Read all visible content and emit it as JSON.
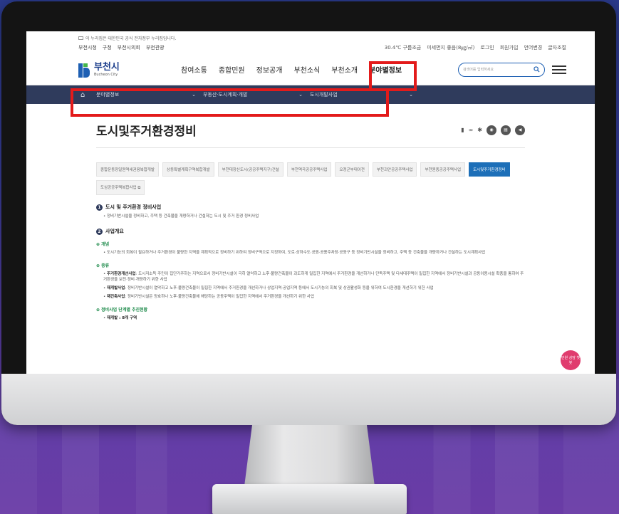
{
  "site": {
    "notice": "이 누리집은 대한민국 공식 전자정부 누리집입니다.",
    "util_left": [
      "부천시청",
      "구청",
      "부천시의회",
      "부천관광"
    ],
    "util_right": [
      "30.4℃ 구름조금",
      "미세먼지 좋음(8㎍/㎥)",
      "로그인",
      "회원가입",
      "언어변경",
      "글자조절"
    ],
    "logo_ko": "부천시",
    "logo_en": "Bucheon City",
    "menu": [
      "참여소통",
      "종합민원",
      "정보공개",
      "부천소식",
      "부천소개",
      "분야별정보"
    ],
    "search_placeholder": "검색어를 입력하세요",
    "subnav": [
      "분야별정보",
      "부동산·도시계획·개발",
      "도시개발사업"
    ]
  },
  "page": {
    "title": "도시및주거환경정비",
    "tabs": [
      "종합운동장일원역세권융복합개발",
      "상동특별계획구역복합개발",
      "부천대장신도시(공공주택지구)건설",
      "부천역곡공공주택사업",
      "오정군부대이전",
      "부천괴안공공주택사업",
      "부천원종공공주택사업",
      "도시및주거환경정비",
      "도심공공주택복합사업"
    ],
    "active_tab": "도시및주거환경정비",
    "sections": {
      "s1_title": "도시 및 주거환경 정비사업",
      "s1_text": "정비기반시설을 정비하고, 주택 등 건축물을 개량하거나 건설하는 도시 및 주거 환경 정비사업",
      "s2_title": "사업개요",
      "concept_h": "개념",
      "concept_text": "도시기능의 회복이 필요하거나 주거환경이 불량한 지역을 계획적으로 정비하기 위하여 정비구역으로 지정하여, 도로·상하수도·공원·공용주차장·공동구 등 정비기반시설을 정비하고, 주택 등 건축물을 개량하거나 건설하는 도시계획사업",
      "types_h": "종류",
      "type1_name": "주거환경개선사업",
      "type1_text": ": 도시저소득 주민이 집단거주하는 지역으로서 정비기반시설이 극히 열악하고 노후·불량건축물이 과도하게 밀집한 지역에서 주거환경을 개선하거나 단독주택 및 다세대주택이 밀집한 지역에서 정비기반시설과 공동이용시설 확충을 통하여 주거환경을 보전·정비·개량하기 위한 사업",
      "type2_name": "재개발사업",
      "type2_text": ": 정비기반시설이 열악하고 노후·불량건축물이 밀집한 지역에서 주거환경을 개선하거나 상업지역·공업지역 등에서 도시기능의 회복 및 상권활성화 등을 위하여 도시환경을 개선하기 위한 사업",
      "type3_name": "재건축사업",
      "type3_text": ": 정비기반시설은 양호하나 노후·불량건축물에 해당하는 공동주택이 밀집한 지역에서 주거환경을 개선하기 위한 사업",
      "stage_h": "정비사업 단계별 추진현황",
      "stage_item": "재개발 : 8개 구역"
    },
    "float_button": "민원 상담 챗봇"
  }
}
